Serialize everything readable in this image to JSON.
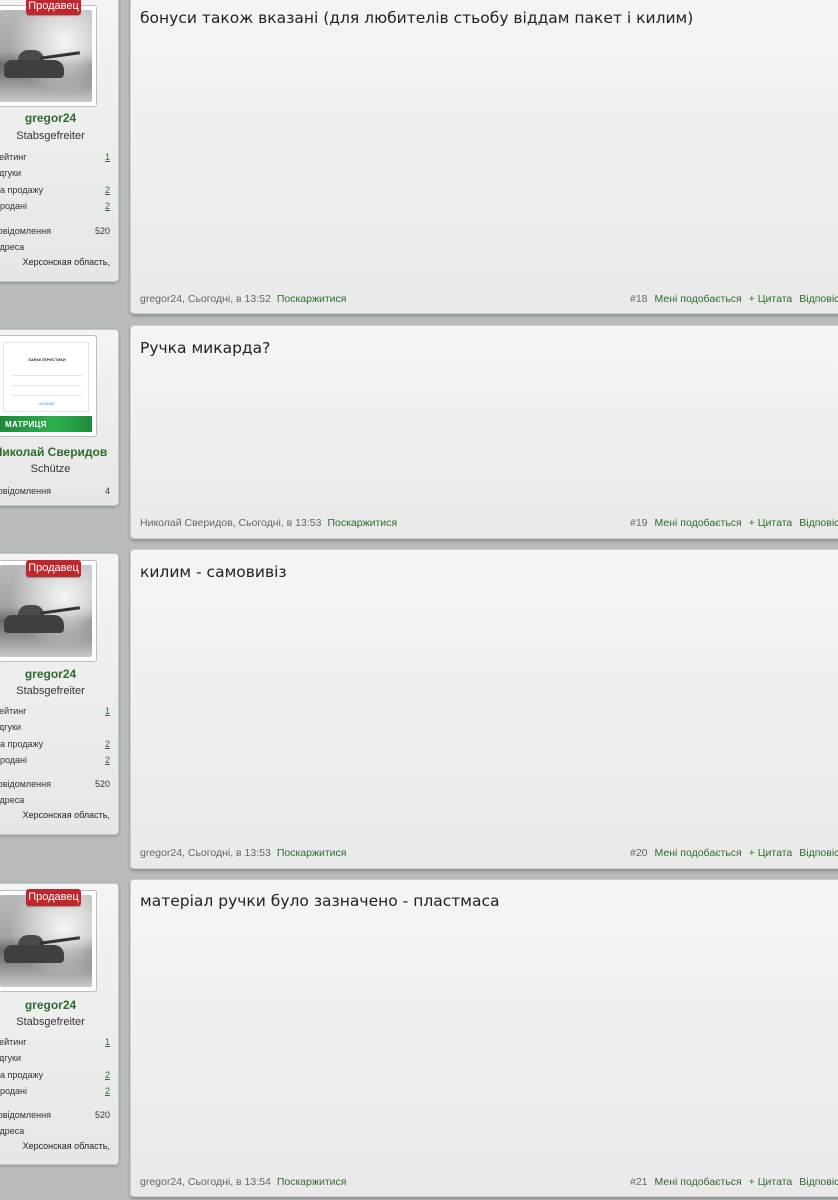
{
  "posts": [
    {
      "author": "gregor24",
      "rank": "Stabsgefreiter",
      "badge": "Продавец",
      "avatar": "tank-avatar",
      "stats": [
        {
          "label": "Рейтинг:",
          "value": "1",
          "link": true
        },
        {
          "label": "Відгуки",
          "value": "",
          "link": false
        },
        {
          "label": "На продажу:",
          "value": "2",
          "link": true
        },
        {
          "label": "Продані:",
          "value": "2",
          "link": true
        },
        {
          "label": "Повідомлення:",
          "value": "520",
          "link": false
        },
        {
          "label": "Адреса:",
          "value": "",
          "link": false
        }
      ],
      "location": "Херсонская область,",
      "text": "бонуси також вказані (для любителів стьобу віддам пакет і килим)",
      "meta": "gregor24, Сьогодні, в 13:52",
      "report": "Поскаржитися",
      "number": "#18",
      "like": "Мені подобається",
      "quote": "+ Цитата",
      "reply": "Відповісти"
    },
    {
      "author": "Николай Сверидов",
      "rank": "Schütze",
      "badge": "",
      "avatar": "promo-avatar",
      "promo_title": "ХАРАКТЕРИСТИКИ",
      "promo_link": "БІЛЬШЕ",
      "promo_banner": "МАТРИЦЯ",
      "stats": [
        {
          "label": "Повідомлення:",
          "value": "4",
          "link": false
        }
      ],
      "location": "",
      "text": "Ручка микарда?",
      "meta": "Николай Сверидов, Сьогодні, в 13:53",
      "report": "Поскаржитися",
      "number": "#19",
      "like": "Мені подобається",
      "quote": "+ Цитата",
      "reply": "Відповісти"
    },
    {
      "author": "gregor24",
      "rank": "Stabsgefreiter",
      "badge": "Продавец",
      "avatar": "tank-avatar",
      "stats": [
        {
          "label": "Рейтинг:",
          "value": "1",
          "link": true
        },
        {
          "label": "Відгуки",
          "value": "",
          "link": false
        },
        {
          "label": "На продажу:",
          "value": "2",
          "link": true
        },
        {
          "label": "Продані:",
          "value": "2",
          "link": true
        },
        {
          "label": "Повідомлення:",
          "value": "520",
          "link": false
        },
        {
          "label": "Адреса:",
          "value": "",
          "link": false
        }
      ],
      "location": "Херсонская область,",
      "text": "килим - самовивіз",
      "meta": "gregor24, Сьогодні, в 13:53",
      "report": "Поскаржитися",
      "number": "#20",
      "like": "Мені подобається",
      "quote": "+ Цитата",
      "reply": "Відповісти"
    },
    {
      "author": "gregor24",
      "rank": "Stabsgefreiter",
      "badge": "Продавец",
      "avatar": "tank-avatar",
      "stats": [
        {
          "label": "Рейтинг:",
          "value": "1",
          "link": true
        },
        {
          "label": "Відгуки",
          "value": "",
          "link": false
        },
        {
          "label": "На продажу:",
          "value": "2",
          "link": true
        },
        {
          "label": "Продані:",
          "value": "2",
          "link": true
        },
        {
          "label": "Повідомлення:",
          "value": "520",
          "link": false
        },
        {
          "label": "Адреса:",
          "value": "",
          "link": false
        }
      ],
      "location": "Херсонская область,",
      "text": "матеріал ручки було зазначено - пластмаса",
      "meta": "gregor24, Сьогодні, в 13:54",
      "report": "Поскаржитися",
      "number": "#21",
      "like": "Мені подобається",
      "quote": "+ Цитата",
      "reply": "Відповісти"
    }
  ]
}
